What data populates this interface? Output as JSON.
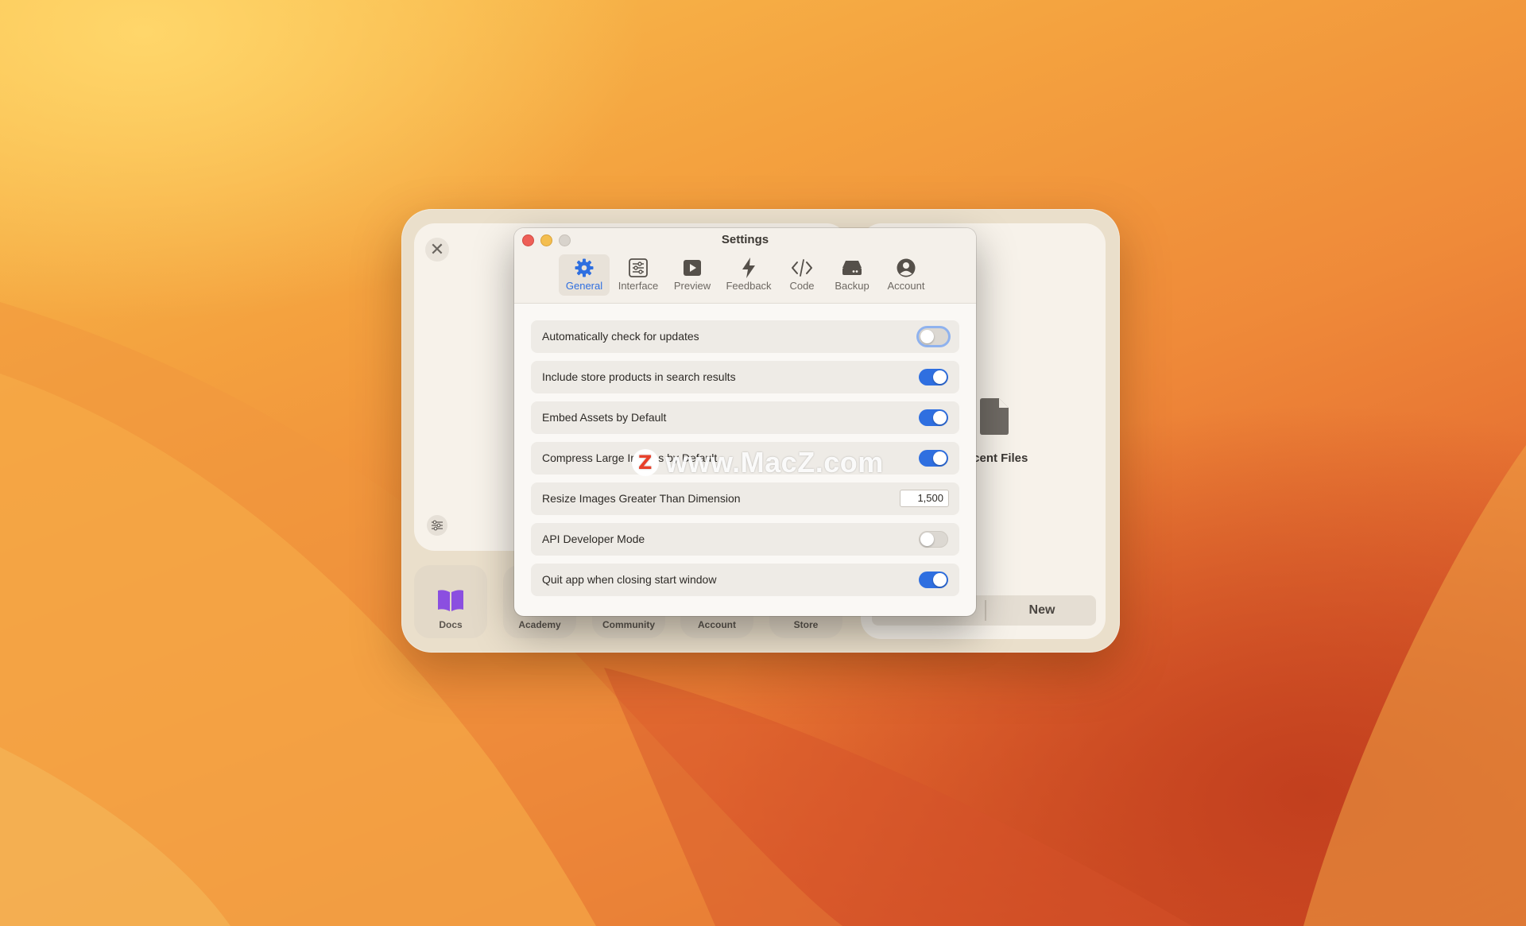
{
  "settings_window": {
    "title": "Settings",
    "tabs": [
      {
        "label": "General",
        "icon": "gear-icon",
        "active": true
      },
      {
        "label": "Interface",
        "icon": "sliders-icon",
        "active": false
      },
      {
        "label": "Preview",
        "icon": "play-icon",
        "active": false
      },
      {
        "label": "Feedback",
        "icon": "bolt-icon",
        "active": false
      },
      {
        "label": "Code",
        "icon": "code-icon",
        "active": false
      },
      {
        "label": "Backup",
        "icon": "drive-icon",
        "active": false
      },
      {
        "label": "Account",
        "icon": "person-circle-icon",
        "active": false
      }
    ],
    "options": [
      {
        "label": "Automatically check for updates",
        "enabled": false
      },
      {
        "label": "Include store products in search results",
        "enabled": true
      },
      {
        "label": "Embed Assets by Default",
        "enabled": true
      },
      {
        "label": "Compress Large Images by Default",
        "enabled": true
      },
      {
        "label": "Resize Images Greater Than Dimension",
        "value": "1,500"
      },
      {
        "label": "API Developer Mode",
        "enabled": false
      },
      {
        "label": "Quit app when closing start window",
        "enabled": true
      }
    ]
  },
  "launcher": {
    "close_symbol": "✕",
    "recent_files_label": "Recent Files",
    "new_button": "New",
    "tiles": [
      "Docs",
      "Academy",
      "Community",
      "Account",
      "Store"
    ]
  },
  "watermark": {
    "logo": "Z",
    "text": "www.MacZ.com"
  },
  "colors": {
    "accent": "#2f6fe0",
    "docs_icon": "#8b4fe0"
  }
}
